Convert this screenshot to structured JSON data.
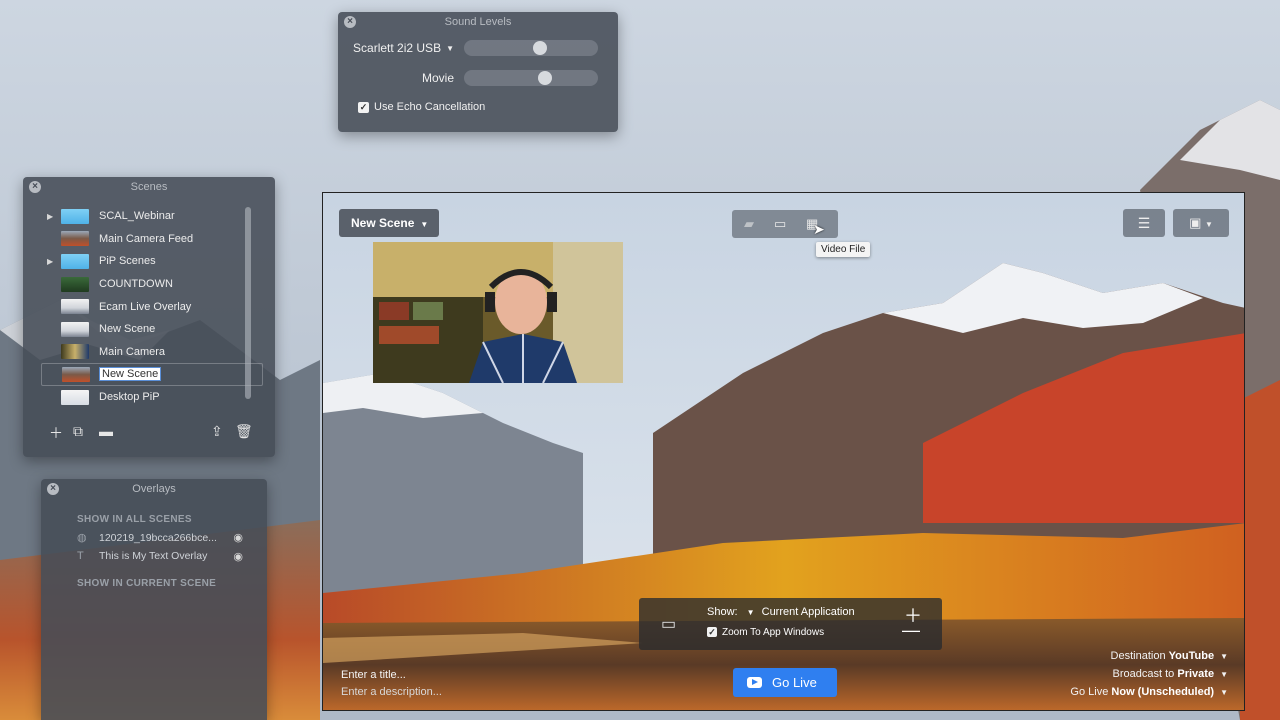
{
  "sound_levels": {
    "title": "Sound Levels",
    "inputs": [
      {
        "label": "Scarlett 2i2 USB",
        "has_dropdown": true,
        "level": 0.58
      },
      {
        "label": "Movie",
        "has_dropdown": false,
        "level": 0.62
      }
    ],
    "echo_cancellation": {
      "label": "Use Echo Cancellation",
      "checked": true
    }
  },
  "scenes": {
    "title": "Scenes",
    "items": [
      {
        "label": "SCAL_Webinar",
        "type": "folder",
        "thumb": "folder"
      },
      {
        "label": "Main Camera Feed",
        "type": "scene",
        "thumb": "landscape"
      },
      {
        "label": "PiP Scenes",
        "type": "folder",
        "thumb": "folder"
      },
      {
        "label": "COUNTDOWN",
        "type": "scene",
        "thumb": "countdown"
      },
      {
        "label": "Ecam Live Overlay",
        "type": "scene",
        "thumb": "overlay"
      },
      {
        "label": "New Scene",
        "type": "scene",
        "thumb": "overlay"
      },
      {
        "label": "Main Camera",
        "type": "scene",
        "thumb": "camera"
      },
      {
        "label": "New Scene",
        "type": "scene",
        "thumb": "landscape",
        "selected": true
      },
      {
        "label": "Desktop PiP",
        "type": "scene",
        "thumb": "desktop"
      }
    ],
    "tools": [
      "plus-icon",
      "duplicate-icon",
      "new-folder-icon",
      "share-icon",
      "trash-icon"
    ]
  },
  "overlays": {
    "title": "Overlays",
    "section_all": "SHOW IN ALL SCENES",
    "items": [
      {
        "label": "120219_19bcca266bce...",
        "icon": "globe-icon"
      },
      {
        "label": "This is My Text Overlay",
        "icon": "text-icon"
      }
    ],
    "section_current": "SHOW IN CURRENT SCENE"
  },
  "main": {
    "scene_dropdown": "New Scene",
    "tooltip": "Video File",
    "show_bar": {
      "show_label": "Show:",
      "show_value": "Current Application",
      "zoom_label": "Zoom To App Windows",
      "zoom_checked": true
    },
    "title_placeholder": "Enter a title...",
    "desc_placeholder": "Enter a description...",
    "go_live_label": "Go Live",
    "destination_label": "Destination",
    "destination_value": "YouTube",
    "broadcast_label": "Broadcast to",
    "broadcast_value": "Private",
    "golive_label": "Go Live",
    "golive_value": "Now (Unscheduled)"
  },
  "colors": {
    "accent": "#2f7ff0",
    "panel": "#464c56"
  }
}
